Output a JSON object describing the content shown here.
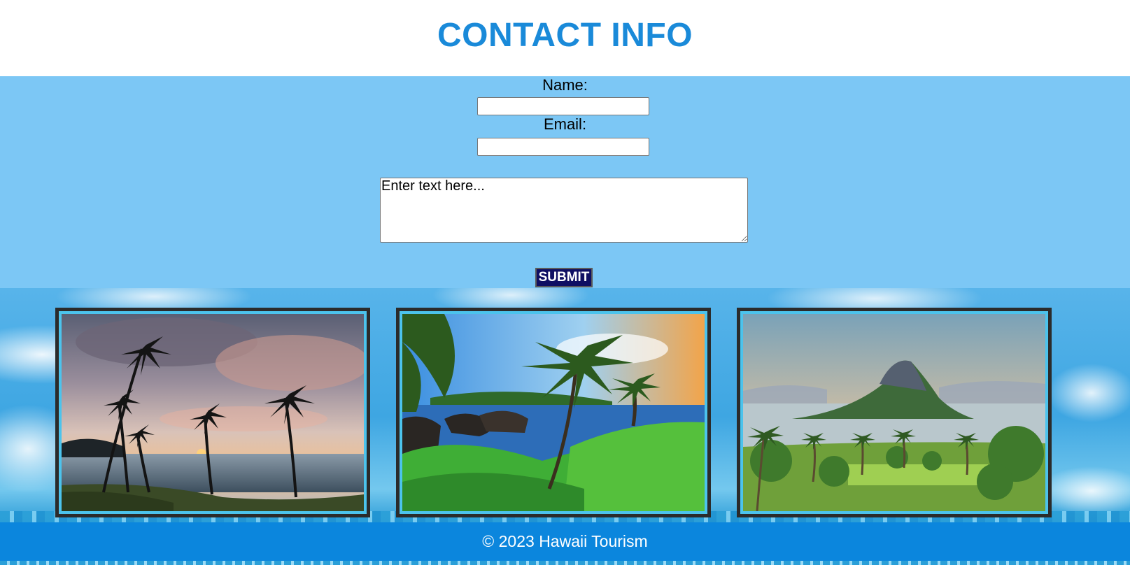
{
  "header": {
    "title": "CONTACT INFO"
  },
  "form": {
    "name_label": "Name:",
    "name_value": "",
    "email_label": "Email:",
    "email_value": "",
    "message_placeholder": "Enter text here...",
    "submit_label": "SUBMIT"
  },
  "gallery": {
    "images": [
      {
        "subject": "sunset beach with palm trees"
      },
      {
        "subject": "tropical lagoon with palm trees"
      },
      {
        "subject": "island peak with palm trees"
      }
    ]
  },
  "footer": {
    "text": "© 2023 Hawaii Tourism"
  },
  "colors": {
    "title": "#1a8ad9",
    "form_band": "#7cc7f5",
    "submit_bg": "#0f0f63",
    "footer_bg": "#0b86dd",
    "frame_border": "#2b2b2b",
    "frame_inner": "#4cc3ec"
  }
}
